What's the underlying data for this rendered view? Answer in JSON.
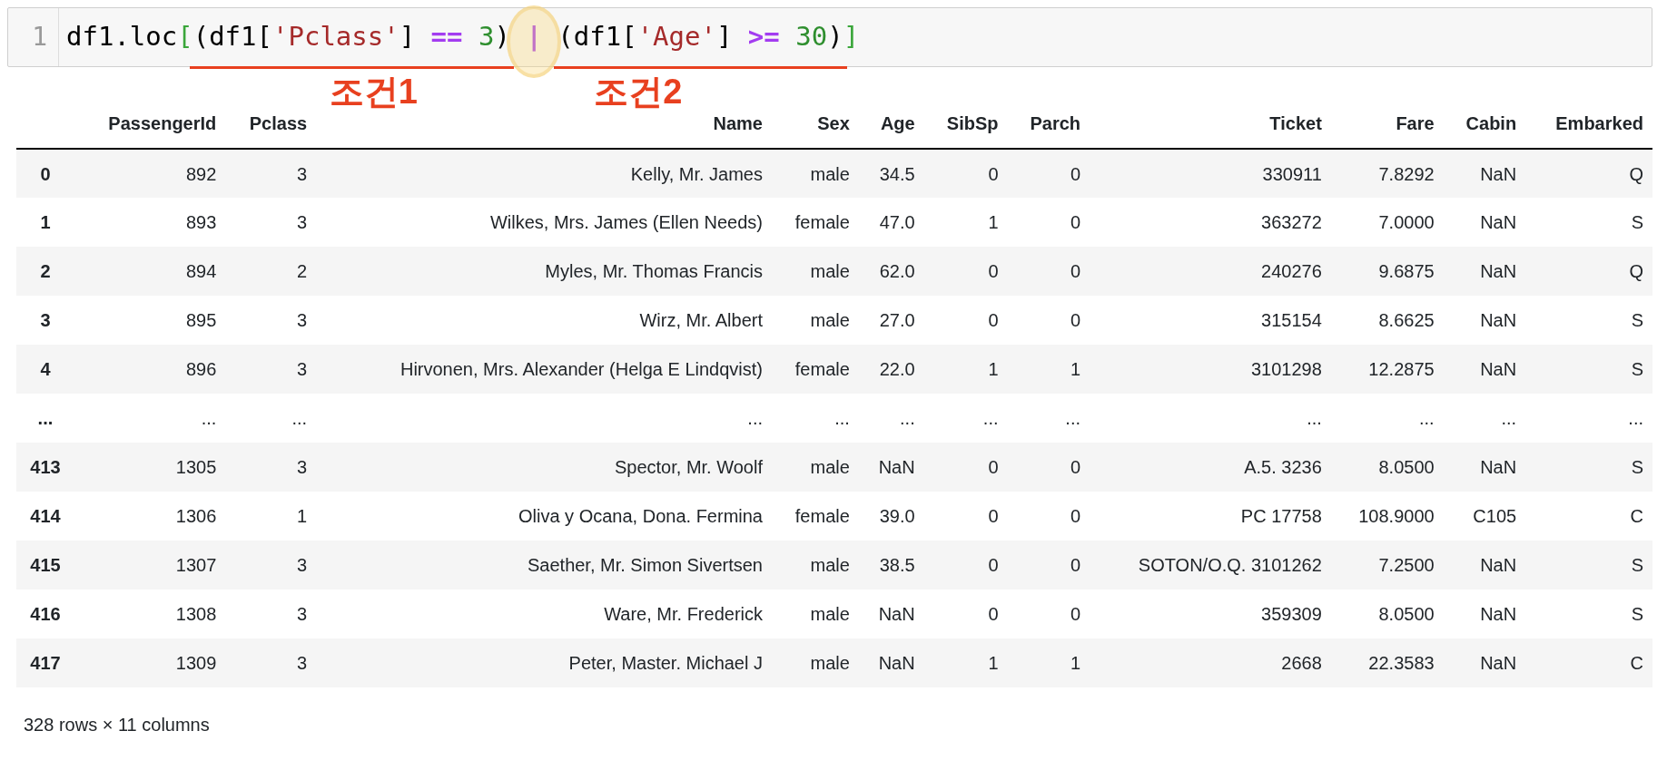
{
  "code_cell": {
    "line_number": "1",
    "parts": [
      {
        "kind": "plain",
        "text": "df1.loc"
      },
      {
        "kind": "bracket",
        "text": "["
      },
      {
        "kind": "group",
        "label": "조건1",
        "tokens": [
          {
            "kind": "plain",
            "text": "(df1["
          },
          {
            "kind": "string",
            "text": "'Pclass'"
          },
          {
            "kind": "plain",
            "text": "] "
          },
          {
            "kind": "op",
            "text": "=="
          },
          {
            "kind": "number",
            "text": " 3"
          },
          {
            "kind": "plain",
            "text": ")"
          }
        ]
      },
      {
        "kind": "op",
        "text": " | ",
        "highlighted": true
      },
      {
        "kind": "group",
        "label": "조건2",
        "tokens": [
          {
            "kind": "plain",
            "text": "(df1["
          },
          {
            "kind": "string",
            "text": "'Age'"
          },
          {
            "kind": "plain",
            "text": "] "
          },
          {
            "kind": "op",
            "text": ">="
          },
          {
            "kind": "number",
            "text": " 30"
          },
          {
            "kind": "plain",
            "text": ")"
          }
        ]
      },
      {
        "kind": "bracket",
        "text": "]"
      }
    ]
  },
  "table": {
    "columns": [
      "PassengerId",
      "Pclass",
      "Name",
      "Sex",
      "Age",
      "SibSp",
      "Parch",
      "Ticket",
      "Fare",
      "Cabin",
      "Embarked"
    ],
    "rows": [
      {
        "index": "0",
        "cells": [
          "892",
          "3",
          "Kelly, Mr. James",
          "male",
          "34.5",
          "0",
          "0",
          "330911",
          "7.8292",
          "NaN",
          "Q"
        ]
      },
      {
        "index": "1",
        "cells": [
          "893",
          "3",
          "Wilkes, Mrs. James (Ellen Needs)",
          "female",
          "47.0",
          "1",
          "0",
          "363272",
          "7.0000",
          "NaN",
          "S"
        ]
      },
      {
        "index": "2",
        "cells": [
          "894",
          "2",
          "Myles, Mr. Thomas Francis",
          "male",
          "62.0",
          "0",
          "0",
          "240276",
          "9.6875",
          "NaN",
          "Q"
        ]
      },
      {
        "index": "3",
        "cells": [
          "895",
          "3",
          "Wirz, Mr. Albert",
          "male",
          "27.0",
          "0",
          "0",
          "315154",
          "8.6625",
          "NaN",
          "S"
        ]
      },
      {
        "index": "4",
        "cells": [
          "896",
          "3",
          "Hirvonen, Mrs. Alexander (Helga E Lindqvist)",
          "female",
          "22.0",
          "1",
          "1",
          "3101298",
          "12.2875",
          "NaN",
          "S"
        ]
      },
      {
        "index": "...",
        "cells": [
          "...",
          "...",
          "...",
          "...",
          "...",
          "...",
          "...",
          "...",
          "...",
          "...",
          "..."
        ]
      },
      {
        "index": "413",
        "cells": [
          "1305",
          "3",
          "Spector, Mr. Woolf",
          "male",
          "NaN",
          "0",
          "0",
          "A.5. 3236",
          "8.0500",
          "NaN",
          "S"
        ]
      },
      {
        "index": "414",
        "cells": [
          "1306",
          "1",
          "Oliva y Ocana, Dona. Fermina",
          "female",
          "39.0",
          "0",
          "0",
          "PC 17758",
          "108.9000",
          "C105",
          "C"
        ]
      },
      {
        "index": "415",
        "cells": [
          "1307",
          "3",
          "Saether, Mr. Simon Sivertsen",
          "male",
          "38.5",
          "0",
          "0",
          "SOTON/O.Q. 3101262",
          "7.2500",
          "NaN",
          "S"
        ]
      },
      {
        "index": "416",
        "cells": [
          "1308",
          "3",
          "Ware, Mr. Frederick",
          "male",
          "NaN",
          "0",
          "0",
          "359309",
          "8.0500",
          "NaN",
          "S"
        ]
      },
      {
        "index": "417",
        "cells": [
          "1309",
          "3",
          "Peter, Master. Michael J",
          "male",
          "NaN",
          "1",
          "1",
          "2668",
          "22.3583",
          "NaN",
          "C"
        ]
      }
    ]
  },
  "footer": "328 rows × 11 columns"
}
